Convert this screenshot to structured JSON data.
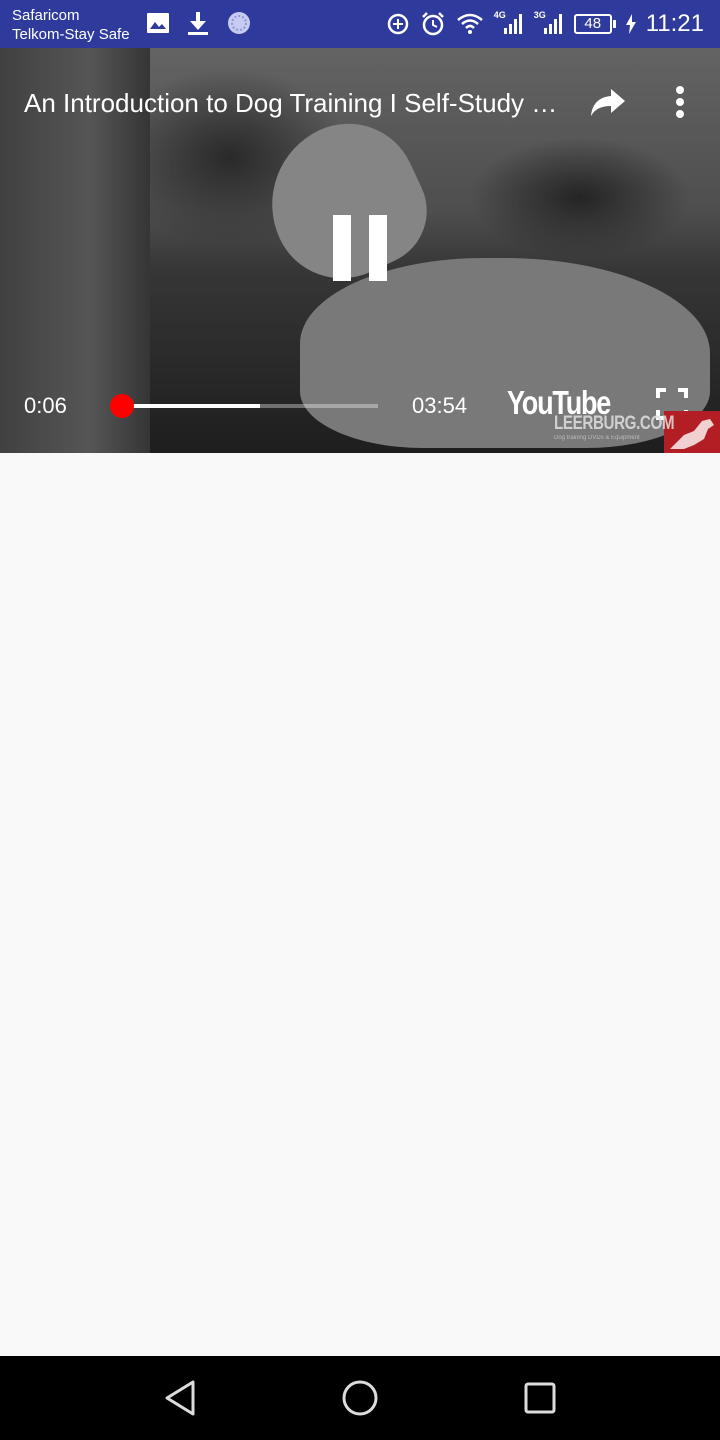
{
  "status_bar": {
    "carrier_line1": "Safaricom",
    "carrier_line2": "Telkom-Stay Safe",
    "network_1": "4G",
    "network_2": "3G",
    "battery": "48",
    "time": "11:21",
    "left_icons": [
      "image-icon",
      "download-icon",
      "sync-icon"
    ],
    "right_icons": [
      "data-saver-icon",
      "alarm-icon",
      "wifi-icon",
      "signal-icon",
      "signal-icon",
      "battery-icon",
      "charging-icon"
    ]
  },
  "player": {
    "title": "An Introduction to Dog Training I Self-Study Course",
    "current_time": "0:06",
    "total_time": "03:54",
    "played_fraction": 0.026,
    "buffered_fraction": 0.55,
    "logo": "YouTube",
    "watermark": "LEERBURG.COM",
    "watermark_sub": "Dog training DVDs & Equipment",
    "accent_color": "#ff0000"
  },
  "nav_bar": {
    "buttons": [
      "back-icon",
      "home-icon",
      "recents-icon"
    ]
  },
  "colors": {
    "status_bar_bg": "#2f3a9d",
    "content_bg": "#f9f9f9",
    "nav_bar_bg": "#000000"
  }
}
